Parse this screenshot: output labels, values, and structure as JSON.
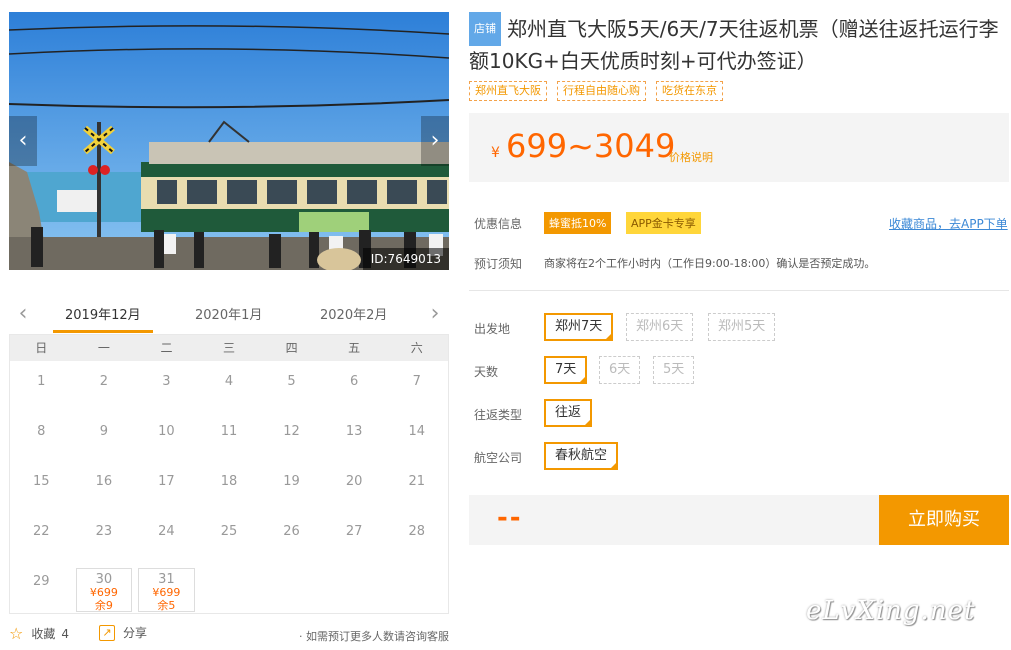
{
  "gallery": {
    "image_id": "ID:7649013",
    "prev_label": "‹",
    "next_label": "›"
  },
  "calendar": {
    "prev_label": "‹",
    "next_label": "›",
    "months": [
      "2019年12月",
      "2020年1月",
      "2020年2月"
    ],
    "weekdays": [
      "日",
      "一",
      "二",
      "三",
      "四",
      "五",
      "六"
    ],
    "days": [
      {
        "d": "1"
      },
      {
        "d": "2"
      },
      {
        "d": "3"
      },
      {
        "d": "4"
      },
      {
        "d": "5"
      },
      {
        "d": "6"
      },
      {
        "d": "7"
      },
      {
        "d": "8"
      },
      {
        "d": "9"
      },
      {
        "d": "10"
      },
      {
        "d": "11"
      },
      {
        "d": "12"
      },
      {
        "d": "13"
      },
      {
        "d": "14"
      },
      {
        "d": "15"
      },
      {
        "d": "16"
      },
      {
        "d": "17"
      },
      {
        "d": "18"
      },
      {
        "d": "19"
      },
      {
        "d": "20"
      },
      {
        "d": "21"
      },
      {
        "d": "22"
      },
      {
        "d": "23"
      },
      {
        "d": "24"
      },
      {
        "d": "25"
      },
      {
        "d": "26"
      },
      {
        "d": "27"
      },
      {
        "d": "28"
      },
      {
        "d": "29"
      },
      {
        "d": "30",
        "price": "¥699",
        "stock": "余9"
      },
      {
        "d": "31",
        "price": "¥699",
        "stock": "余5"
      }
    ]
  },
  "footer": {
    "collect_label": "收藏",
    "collect_count": "4",
    "share_label": "分享",
    "note": "· 如需预订更多人数请咨询客服"
  },
  "product": {
    "shop_badge": "店铺",
    "title": "郑州直飞大阪5天/6天/7天往返机票（赠送往返托运行李额10KG+白天优质时刻+可代办签证）",
    "tags": [
      "郑州直飞大阪",
      "行程自由随心购",
      "吃货在东京"
    ],
    "currency": "¥",
    "price_range": "699~3049",
    "price_explain": "价格说明"
  },
  "info": {
    "promo_label": "优惠信息",
    "promo_a": "蜂蜜抵10%",
    "promo_b": "APP金卡专享",
    "collect_link": "收藏商品，去APP下单",
    "notice_label": "预订须知",
    "notice_text": "商家将在2个工作小时内（工作日9:00-18:00）确认是否预定成功。"
  },
  "options": {
    "departure_label": "出发地",
    "departure": [
      {
        "label": "郑州7天",
        "state": "selected"
      },
      {
        "label": "郑州6天",
        "state": "disabled"
      },
      {
        "label": "郑州5天",
        "state": "disabled"
      }
    ],
    "days_label": "天数",
    "days": [
      {
        "label": "7天",
        "state": "selected"
      },
      {
        "label": "6天",
        "state": "disabled"
      },
      {
        "label": "5天",
        "state": "disabled"
      }
    ],
    "trip_label": "往返类型",
    "trip": [
      {
        "label": "往返",
        "state": "selected"
      }
    ],
    "airline_label": "航空公司",
    "airline": [
      {
        "label": "春秋航空",
        "state": "selected"
      }
    ]
  },
  "buy": {
    "total": "--",
    "button_label": "立即购买"
  },
  "watermark": "eLvXing.net",
  "colors": {
    "accent": "#f39800",
    "price": "#ff6600",
    "link": "#3b88d6",
    "badge": "#62a8e8"
  }
}
